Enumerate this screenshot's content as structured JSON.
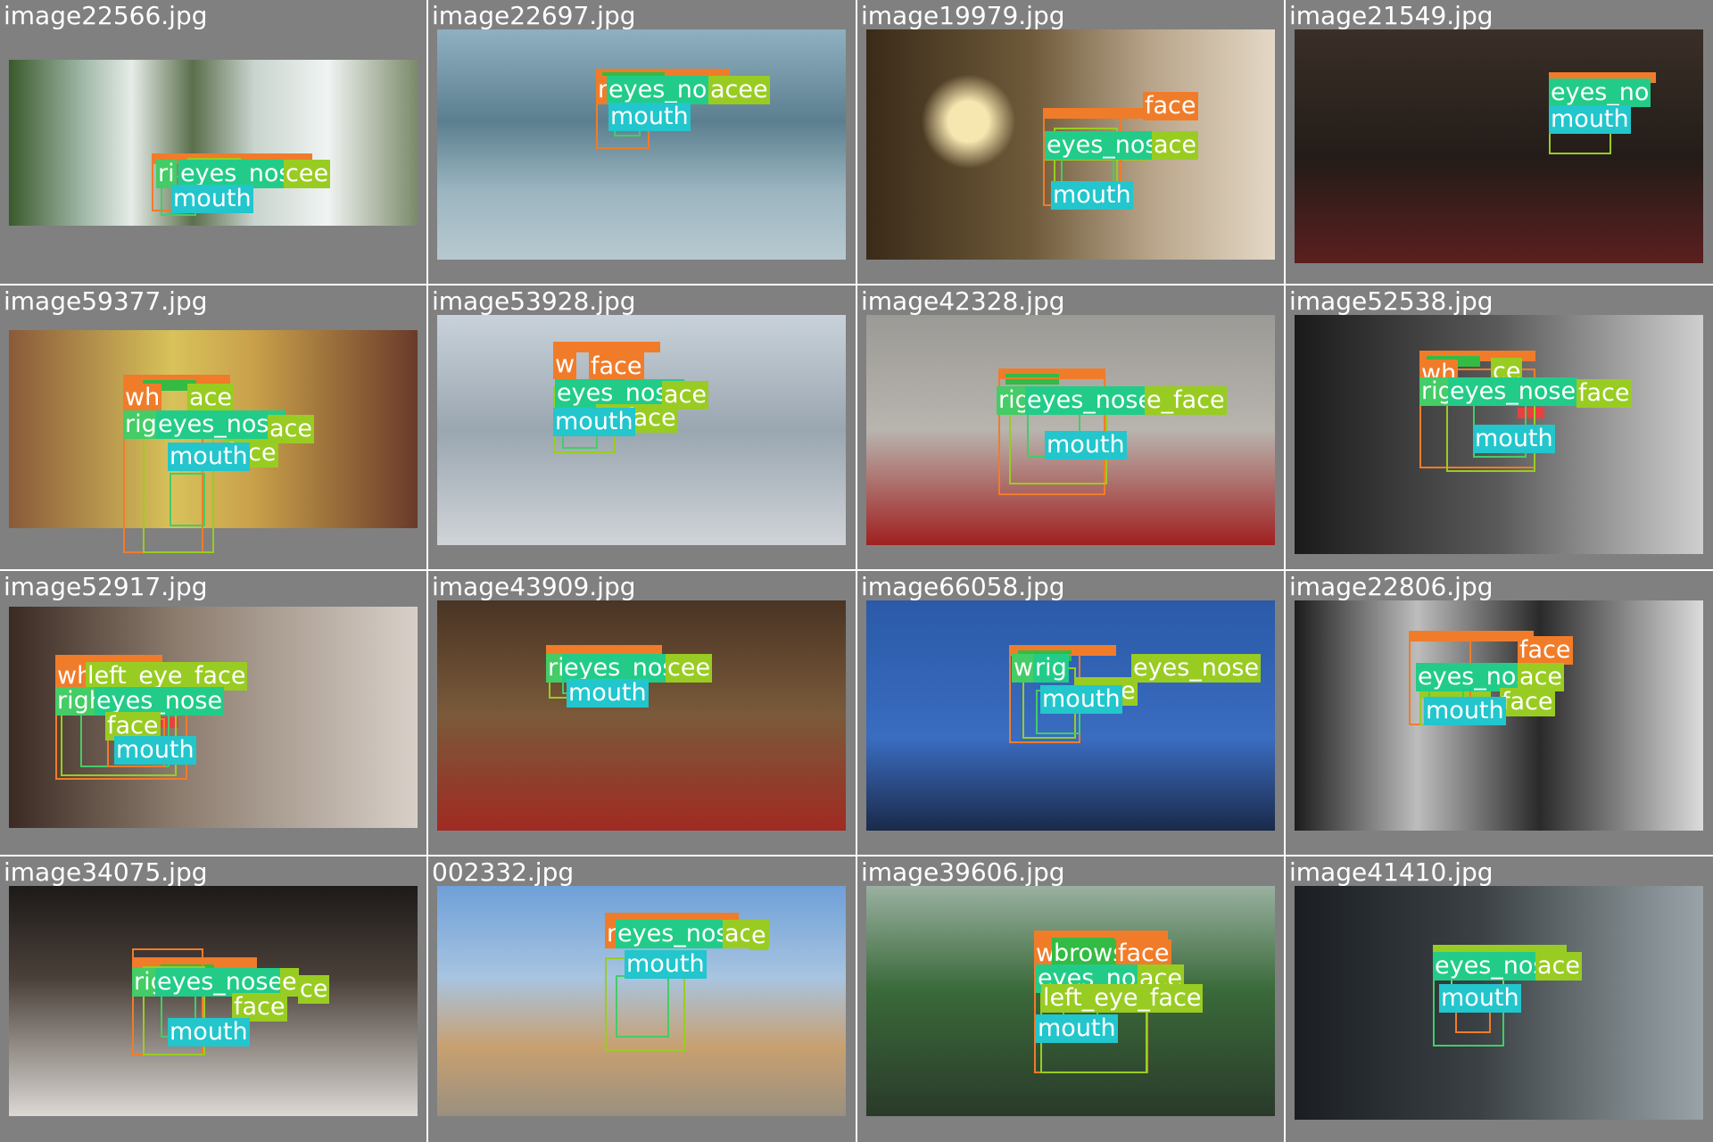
{
  "colors": {
    "grid_background": "#808080",
    "face": "#f07c2a",
    "eyebrows": "#33bb44",
    "eyes_nose": "#22cc88",
    "mouth": "#22c6cc",
    "left_eye": "#99cc22",
    "right_eye": "#44cc66",
    "lip_red": "#e84040"
  },
  "grid": {
    "cells": [
      {
        "filename": "image22566.jpg",
        "labels": [
          "ri",
          "eyes_nose",
          "cee",
          "mouth"
        ]
      },
      {
        "filename": "image22697.jpg",
        "labels": [
          "r",
          "eyes_nose",
          "acee",
          "mouth"
        ]
      },
      {
        "filename": "image19979.jpg",
        "labels": [
          "face",
          "eyes_nose",
          "ace",
          "mouth"
        ]
      },
      {
        "filename": "image21549.jpg",
        "labels": [
          "eyes_no",
          "mouth"
        ]
      },
      {
        "filename": "image59377.jpg",
        "labels": [
          "wh",
          "ace",
          "rig",
          "eyes_nose",
          "ace",
          "face",
          "mouth"
        ]
      },
      {
        "filename": "image53928.jpg",
        "labels": [
          "w",
          "face",
          "eyes_nose",
          "ace",
          "e_face",
          "mouth"
        ]
      },
      {
        "filename": "image42328.jpg",
        "labels": [
          "rig",
          "eyes_nose",
          "e_face",
          "mouth"
        ]
      },
      {
        "filename": "image52538.jpg",
        "labels": [
          "wh",
          "ce",
          "righ",
          "eyes_nose",
          "face",
          "mouth"
        ]
      },
      {
        "filename": "image52917.jpg",
        "labels": [
          "wh",
          "left_eye_face",
          "righ",
          "eyes_nose",
          "face",
          "mouth"
        ]
      },
      {
        "filename": "image43909.jpg",
        "labels": [
          "ri",
          "eyes_nose",
          "cee",
          "mouth"
        ]
      },
      {
        "filename": "image66058.jpg",
        "labels": [
          "w",
          "rig",
          "eyes_nose",
          "eace",
          "face",
          "mouth"
        ]
      },
      {
        "filename": "image22806.jpg",
        "labels": [
          "face",
          "eyes_nose",
          "ace",
          "face",
          "mouth"
        ]
      },
      {
        "filename": "image34075.jpg",
        "labels": [
          "rig",
          "eyes_nose",
          "e",
          "ce",
          "face",
          "mouth"
        ]
      },
      {
        "filename": "002332.jpg",
        "labels": [
          "r",
          "eyes_nos",
          "ace",
          "e",
          "mouth"
        ]
      },
      {
        "filename": "image39606.jpg",
        "labels": [
          "w",
          "brows",
          "face",
          "eyes_nose",
          "ace",
          "left_eye_face",
          "mouth"
        ]
      },
      {
        "filename": "image41410.jpg",
        "labels": [
          "eyes_nose",
          "ace",
          "mouth"
        ]
      }
    ]
  }
}
